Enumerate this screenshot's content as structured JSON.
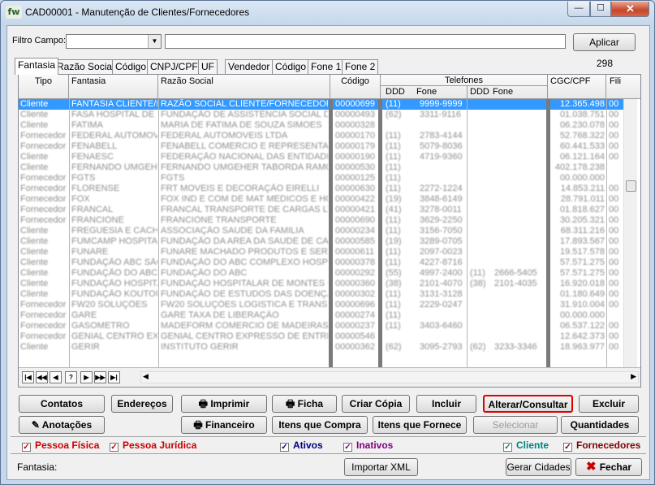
{
  "window": {
    "title": "CAD00001 - Manutenção de Clientes/Fornecedores",
    "icon": "fw",
    "minimize": "—",
    "maximize": "☐",
    "close": "✕"
  },
  "filter": {
    "label": "Filtro Campo:",
    "combo_value": "",
    "text_value": "",
    "apply_label": "Aplicar"
  },
  "tabs": [
    "Fantasia",
    "Razão Social",
    "Código",
    "CNPJ/CPF",
    "UF",
    "Vendedor",
    "Código",
    "Fone 1",
    "Fone 2"
  ],
  "record_count": "298",
  "grid": {
    "headers": {
      "tipo": "Tipo",
      "fantasia": "Fantasia",
      "razao": "Razão Social",
      "codigo": "Código",
      "telefones": "Telefones",
      "ddd1": "DDD",
      "fone1": "Fone",
      "ddd2": "DDD",
      "fone2": "Fone",
      "cgc": "CGC/CPF",
      "fili": "Fili"
    },
    "rows": [
      {
        "tipo": "Cliente",
        "fantasia": "FANTASIA CLIENTE/FORNECEDOR",
        "razao": "RAZÃO SOCIAL CLIENTE/FORNECEDOR",
        "codigo": "00000699",
        "ddd1": "(11)",
        "fone1": "9999-9999",
        "ddd2": "",
        "fone2": "",
        "cgc": "12.365.498",
        "fili": "00"
      },
      {
        "tipo": "Cliente",
        "fantasia": "FASA HOSPITAL DE FAS",
        "razao": "FUNDAÇÃO DE ASSISTÊNCIA SOCIAL DE",
        "codigo": "00000493",
        "ddd1": "(62)",
        "fone1": "3311-9116",
        "ddd2": "",
        "fone2": "",
        "cgc": "01.038.751",
        "fili": "00"
      },
      {
        "tipo": "Cliente",
        "fantasia": "FATIMA",
        "razao": "MARIA DE FATIMA DE SOUZA SIMOES",
        "codigo": "00000328",
        "ddd1": "",
        "fone1": "",
        "ddd2": "",
        "fone2": "",
        "cgc": "06.230.078",
        "fili": "00"
      },
      {
        "tipo": "Fornecedor",
        "fantasia": "FEDERAL AUTOMOVEIS",
        "razao": "FEDERAL AUTOMOVEIS LTDA",
        "codigo": "00000170",
        "ddd1": "(11)",
        "fone1": "2783-4144",
        "ddd2": "",
        "fone2": "",
        "cgc": "52.768.322",
        "fili": "00"
      },
      {
        "tipo": "Fornecedor",
        "fantasia": "FENABELL",
        "razao": "FENABELL COMERCIO E REPRESENTAÇ",
        "codigo": "00000179",
        "ddd1": "(11)",
        "fone1": "5079-8036",
        "ddd2": "",
        "fone2": "",
        "cgc": "60.441.533",
        "fili": "00"
      },
      {
        "tipo": "Cliente",
        "fantasia": "FENAESC",
        "razao": "FEDERAÇÃO NACIONAL DAS ENTIDADES",
        "codigo": "00000190",
        "ddd1": "(11)",
        "fone1": "4719-9360",
        "ddd2": "",
        "fone2": "",
        "cgc": "06.121.164",
        "fili": "00"
      },
      {
        "tipo": "Cliente",
        "fantasia": "FERNANDO UMGEHER",
        "razao": "FERNANDO UMGEHER TABORDA RAMOS",
        "codigo": "00000530",
        "ddd1": "(11)",
        "fone1": "",
        "ddd2": "",
        "fone2": "",
        "cgc": "402.178.238",
        "fili": ""
      },
      {
        "tipo": "Fornecedor",
        "fantasia": "FGTS",
        "razao": "FGTS",
        "codigo": "00000125",
        "ddd1": "(11)",
        "fone1": "",
        "ddd2": "",
        "fone2": "",
        "cgc": "00.000.000",
        "fili": ""
      },
      {
        "tipo": "Fornecedor",
        "fantasia": "FLORENSE",
        "razao": "FRT MOVEIS E DECORAÇÃO EIRELLI",
        "codigo": "00000630",
        "ddd1": "(11)",
        "fone1": "2272-1224",
        "ddd2": "",
        "fone2": "",
        "cgc": "14.853.211",
        "fili": "00"
      },
      {
        "tipo": "Fornecedor",
        "fantasia": "FOX",
        "razao": "FOX IND E COM DE MAT MEDICOS E HOS",
        "codigo": "00000422",
        "ddd1": "(19)",
        "fone1": "3848-6149",
        "ddd2": "",
        "fone2": "",
        "cgc": "28.791.011",
        "fili": "00"
      },
      {
        "tipo": "Fornecedor",
        "fantasia": "FRANCAL",
        "razao": "FRANCAL TRANSPORTE DE CARGAS LTD",
        "codigo": "00000421",
        "ddd1": "(41)",
        "fone1": "3278-0011",
        "ddd2": "",
        "fone2": "",
        "cgc": "01.818.627",
        "fili": "00"
      },
      {
        "tipo": "Fornecedor",
        "fantasia": "FRANCIONE",
        "razao": "FRANCIONE TRANSPORTE",
        "codigo": "00000690",
        "ddd1": "(11)",
        "fone1": "3629-2250",
        "ddd2": "",
        "fone2": "",
        "cgc": "30.205.321",
        "fili": "00"
      },
      {
        "tipo": "Cliente",
        "fantasia": "FREGUESIA E CACHOEI",
        "razao": "ASSOCIAÇÃO SAUDE DA FAMILIA",
        "codigo": "00000234",
        "ddd1": "(11)",
        "fone1": "3156-7050",
        "ddd2": "",
        "fone2": "",
        "cgc": "68.311.216",
        "fili": "00"
      },
      {
        "tipo": "Cliente",
        "fantasia": "FUMCAMP HOSPITAL N",
        "razao": "FUNDAÇÃO DA AREA DA SAUDE DE CAM",
        "codigo": "00000585",
        "ddd1": "(19)",
        "fone1": "3289-0705",
        "ddd2": "",
        "fone2": "",
        "cgc": "17.893.567",
        "fili": "00"
      },
      {
        "tipo": "Cliente",
        "fantasia": "FUNARE",
        "razao": "FUNARE MACHADO PRODUTOS E SERV",
        "codigo": "00000611",
        "ddd1": "(11)",
        "fone1": "2097-0023",
        "ddd2": "",
        "fone2": "",
        "cgc": "19.517.578",
        "fili": "00"
      },
      {
        "tipo": "Cliente",
        "fantasia": "FUNDAÇÃO ABC SÃO",
        "razao": "FUNDAÇÃO DO ABC COMPLEXO HOSPITAL",
        "codigo": "00000378",
        "ddd1": "(11)",
        "fone1": "4227-8716",
        "ddd2": "",
        "fone2": "",
        "cgc": "57.571.275",
        "fili": "00"
      },
      {
        "tipo": "Cliente",
        "fantasia": "FUNDAÇÃO DO ABC",
        "razao": "FUNDAÇÃO DO ABC",
        "codigo": "00000292",
        "ddd1": "(55)",
        "fone1": "4997-2400",
        "ddd2": "(11)",
        "fone2": "2666-5405",
        "cgc": "57.571.275",
        "fili": "00"
      },
      {
        "tipo": "Cliente",
        "fantasia": "FUNDAÇÃO HOSPITALA",
        "razao": "FUNDAÇÃO HOSPITALAR DE MONTES C",
        "codigo": "00000360",
        "ddd1": "(38)",
        "fone1": "2101-4070",
        "ddd2": "(38)",
        "fone2": "2101-4035",
        "cgc": "16.920.018",
        "fili": "00"
      },
      {
        "tipo": "Cliente",
        "fantasia": "FUNDAÇÃO KOUTOULAS",
        "razao": "FUNDAÇÃO DE ESTUDOS DAS DOENÇAS",
        "codigo": "00000302",
        "ddd1": "(11)",
        "fone1": "3131-3128",
        "ddd2": "",
        "fone2": "",
        "cgc": "01.180.649",
        "fili": "00"
      },
      {
        "tipo": "Fornecedor",
        "fantasia": "FW20 SOLUÇÕES",
        "razao": "FW20 SOLUÇÕES LOGISTICA E TRANSP",
        "codigo": "00000696",
        "ddd1": "(11)",
        "fone1": "2229-0247",
        "ddd2": "",
        "fone2": "",
        "cgc": "31.910.004",
        "fili": "00"
      },
      {
        "tipo": "Fornecedor",
        "fantasia": "GARE",
        "razao": "GARE TAXA DE LIBERAÇÃO",
        "codigo": "00000274",
        "ddd1": "(11)",
        "fone1": "",
        "ddd2": "",
        "fone2": "",
        "cgc": "00.000.000",
        "fili": ""
      },
      {
        "tipo": "Fornecedor",
        "fantasia": "GASOMETRO",
        "razao": "MADEFORM COMERCIO DE MADEIRAS LT",
        "codigo": "00000237",
        "ddd1": "(11)",
        "fone1": "3403-6460",
        "ddd2": "",
        "fone2": "",
        "cgc": "06.537.122",
        "fili": "00"
      },
      {
        "tipo": "Fornecedor",
        "fantasia": "GENIAL CENTRO EXPRE",
        "razao": "GENIAL CENTRO EXPRESSO DE ENTREG",
        "codigo": "00000546",
        "ddd1": "",
        "fone1": "",
        "ddd2": "",
        "fone2": "",
        "cgc": "12.642.373",
        "fili": "00"
      },
      {
        "tipo": "Cliente",
        "fantasia": "GERIR",
        "razao": "INSTITUTO GERIR",
        "codigo": "00000362",
        "ddd1": "(62)",
        "fone1": "3095-2793",
        "ddd2": "(62)",
        "fone2": "3233-3346",
        "cgc": "18.963.977",
        "fili": "00"
      }
    ]
  },
  "nav": [
    "|◀",
    "◀◀",
    "◀",
    "?",
    "▶",
    "▶▶",
    "▶|"
  ],
  "buttons": {
    "contatos": "Contatos",
    "enderecos": "Endereços",
    "imprimir": "Imprimir",
    "ficha": "Ficha",
    "criar_copia": "Criar Cópia",
    "incluir": "Incluir",
    "alterar": "Alterar/Consultar",
    "excluir": "Excluir",
    "anotacoes": "Anotações",
    "financeiro": "Financeiro",
    "itens_compra": "Itens que Compra",
    "itens_fornece": "Itens que Fornece",
    "selecionar": "Selecionar",
    "quantidades": "Quantidades",
    "importar_xml": "Importar XML",
    "gerar_cidades": "Gerar Cidades",
    "fechar": "Fechar"
  },
  "checkboxes": {
    "pessoa_fisica": "Pessoa Física",
    "pessoa_juridica": "Pessoa Jurídica",
    "ativos": "Ativos",
    "inativos": "Inativos",
    "cliente": "Cliente",
    "fornecedores": "Fornecedores",
    "check_mark": "✓"
  },
  "status": {
    "fantasia_label": "Fantasia:"
  },
  "colors": {
    "selection": "#3399ff",
    "highlight_border": "#e00000",
    "pessoa": "#cc0000",
    "ativos": "#000080",
    "inativos": "#800080",
    "cliente": "#008080",
    "fornecedores": "#800000"
  }
}
